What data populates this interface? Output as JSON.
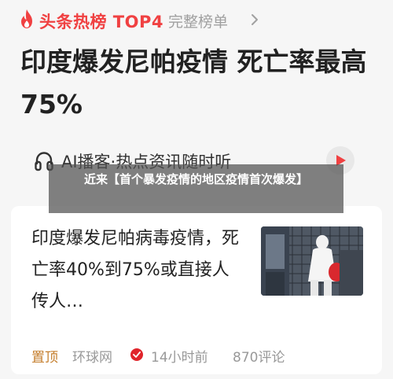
{
  "header": {
    "brand": "头条热榜 TOP4",
    "full_list_link": "完整榜单",
    "brand_color": "#f04142"
  },
  "headline": {
    "text": "印度爆发尼帕疫情 死亡率最高75%"
  },
  "ai_player": {
    "label": "AI播客·热点资讯随时听",
    "icon": "headphones-icon",
    "play_icon": "play-icon"
  },
  "caption": {
    "text": "近来【首个暴发疫情的地区疫情首次爆发】"
  },
  "article": {
    "title": "印度爆发尼帕病毒疫情，死亡率40%到75%或直接人传人…",
    "meta": {
      "pinned": "置顶",
      "source": "环球网",
      "time": "14小时前",
      "comments": "870评论"
    },
    "thumbnail": "news-photo-health-worker-in-protective-suit"
  }
}
